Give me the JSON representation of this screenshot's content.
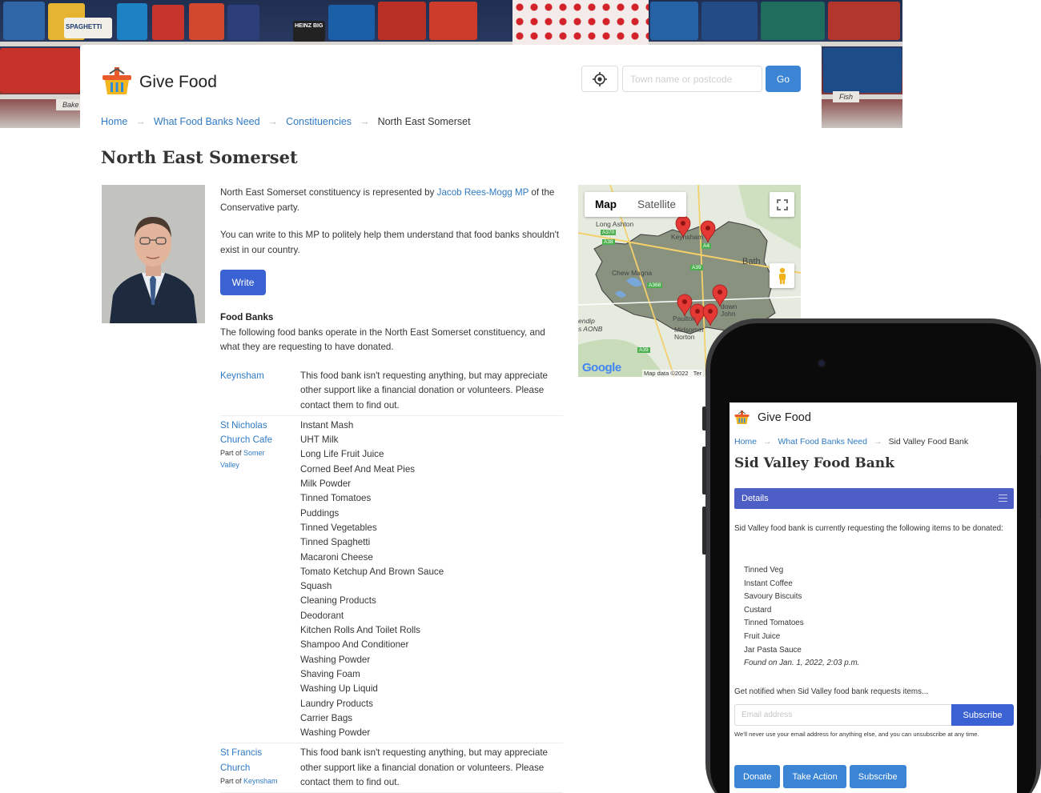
{
  "site": {
    "brand": "Give Food"
  },
  "hero": {
    "tags": [
      "Bake",
      "Fish"
    ],
    "can_labels": [
      "SPAGHETTI",
      "HEINZ BIG"
    ]
  },
  "search": {
    "placeholder": "Town name or postcode",
    "go_label": "Go"
  },
  "breadcrumb": {
    "home": "Home",
    "need": "What Food Banks Need",
    "constituencies": "Constituencies",
    "current": "North East Somerset",
    "separator": "→"
  },
  "page_title": "North East Somerset",
  "intro": {
    "line1_prefix": "North East Somerset constituency is represented by ",
    "mp_link": "Jacob Rees-Mogg MP",
    "line1_suffix": " of the Conservative party.",
    "line2": "You can write to this MP to politely help them understand that food banks shouldn't exist in our country.",
    "write_label": "Write"
  },
  "foodbanks": {
    "heading": "Food Banks",
    "description": "The following food banks operate in the North East Somerset constituency, and what they are requesting to have donated.",
    "part_of_label": "Part of",
    "rows": [
      {
        "name": "Keynsham",
        "part_of": "",
        "needs_text": "This food bank isn't requesting anything, but may appreciate other support like a financial donation or volunteers. Please contact them to find out.",
        "needs": []
      },
      {
        "name": "St Nicholas Church Cafe",
        "part_of": "Somer Valley",
        "needs_text": "",
        "needs": [
          "Instant Mash",
          "UHT Milk",
          "Long Life Fruit Juice",
          "Corned Beef And Meat Pies",
          "Milk Powder",
          "Tinned Tomatoes",
          "Puddings",
          "Tinned Vegetables",
          "Tinned Spaghetti",
          "Macaroni Cheese",
          "Tomato Ketchup And Brown Sauce",
          "Squash",
          "Cleaning Products",
          "Deodorant",
          "Kitchen Rolls And Toilet Rolls",
          "Shampoo And Conditioner",
          "Washing Powder",
          "Shaving Foam",
          "Washing Up Liquid",
          "Laundry Products",
          "Carrier Bags",
          "Washing Powder"
        ]
      },
      {
        "name": "St Francis Church",
        "part_of": "Keynsham",
        "needs_text": "This food bank isn't requesting anything, but may appreciate other support like a financial donation or volunteers. Please contact them to find out.",
        "needs": []
      }
    ]
  },
  "map": {
    "tabs": [
      "Map",
      "Satellite"
    ],
    "active_tab": "Map",
    "place_labels": [
      "Long Ashton",
      "Chew Magna",
      "Bath",
      "endip",
      "s AONB",
      "Keynsham",
      "Paulton",
      "Midsomer Norton",
      "down John"
    ],
    "road_labels": [
      "A370",
      "A38",
      "A4",
      "A39",
      "A368",
      "A39"
    ],
    "attribution": "Map data ©2022",
    "terms": "Ter",
    "google": "Google",
    "marker_count": 6
  },
  "mobile": {
    "brand": "Give Food",
    "breadcrumb": {
      "home": "Home",
      "need": "What Food Banks Need",
      "current": "Sid Valley Food Bank"
    },
    "title": "Sid Valley Food Bank",
    "details_label": "Details",
    "intro": "Sid Valley food bank is currently requesting the following items to be donated:",
    "items": [
      "Tinned Veg",
      "Instant Coffee",
      "Savoury Biscuits",
      "Custard",
      "Tinned Tomatoes",
      "Fruit Juice",
      "Jar Pasta Sauce"
    ],
    "found": "Found on Jan. 1, 2022, 2:03 p.m.",
    "notify": "Get notified when Sid Valley food bank requests items...",
    "email_placeholder": "Email address",
    "subscribe_label": "Subscribe",
    "privacy": "We'll never use your email address for anything else, and you can unsubscribe at any time.",
    "actions": [
      "Donate",
      "Take Action",
      "Subscribe"
    ]
  },
  "colors": {
    "link": "#2f7ac4",
    "primary_button": "#3b85d4",
    "write_button": "#3b62d2",
    "details_bar": "#4d5ec6",
    "map_region": "#7f8a76",
    "marker": "#e53935"
  }
}
